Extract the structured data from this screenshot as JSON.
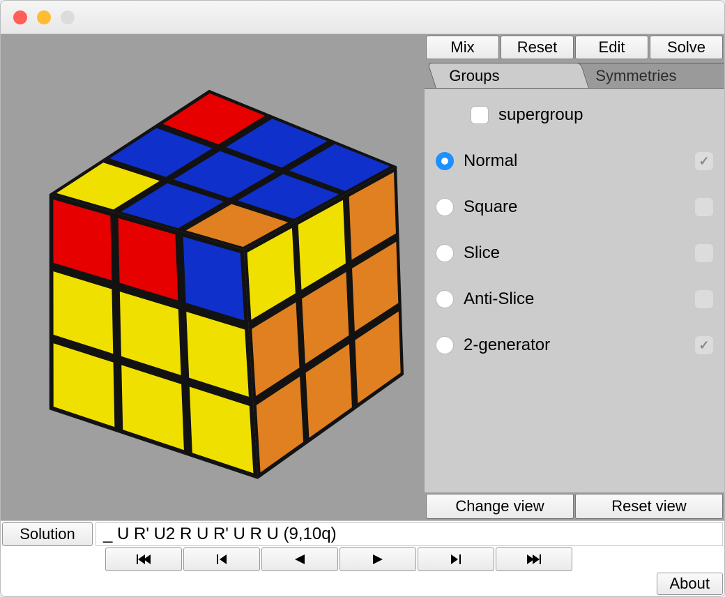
{
  "toolbar": {
    "mix": "Mix",
    "reset": "Reset",
    "edit": "Edit",
    "solve": "Solve"
  },
  "tabs": {
    "groups": "Groups",
    "symmetries": "Symmetries",
    "active": "groups"
  },
  "groups_panel": {
    "supergroup_label": "supergroup",
    "supergroup_checked": false,
    "options": [
      {
        "label": "Normal",
        "selected": true,
        "flag_on": true
      },
      {
        "label": "Square",
        "selected": false,
        "flag_on": false
      },
      {
        "label": "Slice",
        "selected": false,
        "flag_on": false
      },
      {
        "label": "Anti-Slice",
        "selected": false,
        "flag_on": false
      },
      {
        "label": "2-generator",
        "selected": false,
        "flag_on": true
      }
    ]
  },
  "view_buttons": {
    "change": "Change view",
    "reset": "Reset view"
  },
  "solution": {
    "label": "Solution",
    "text": "_ U R' U2 R U R' U R U (9,10q)"
  },
  "playback": {
    "first": "⏮",
    "prev": "◀",
    "back": "◀",
    "fwd": "▶",
    "next": "▶",
    "last": "⏭"
  },
  "about": "About",
  "cube": {
    "colors": {
      "red": "#e60000",
      "blue": "#1030cc",
      "yellow": "#f0e000",
      "orange": "#e08020",
      "black": "#121212"
    },
    "top_face": [
      [
        "red",
        "blue",
        "blue"
      ],
      [
        "blue",
        "blue",
        "blue"
      ],
      [
        "yellow",
        "blue",
        "orange"
      ]
    ],
    "front_face": [
      [
        "red",
        "red",
        "blue"
      ],
      [
        "yellow",
        "yellow",
        "yellow"
      ],
      [
        "yellow",
        "yellow",
        "yellow"
      ]
    ],
    "right_face": [
      [
        "yellow",
        "yellow",
        "orange"
      ],
      [
        "orange",
        "orange",
        "orange"
      ],
      [
        "orange",
        "orange",
        "orange"
      ]
    ]
  }
}
